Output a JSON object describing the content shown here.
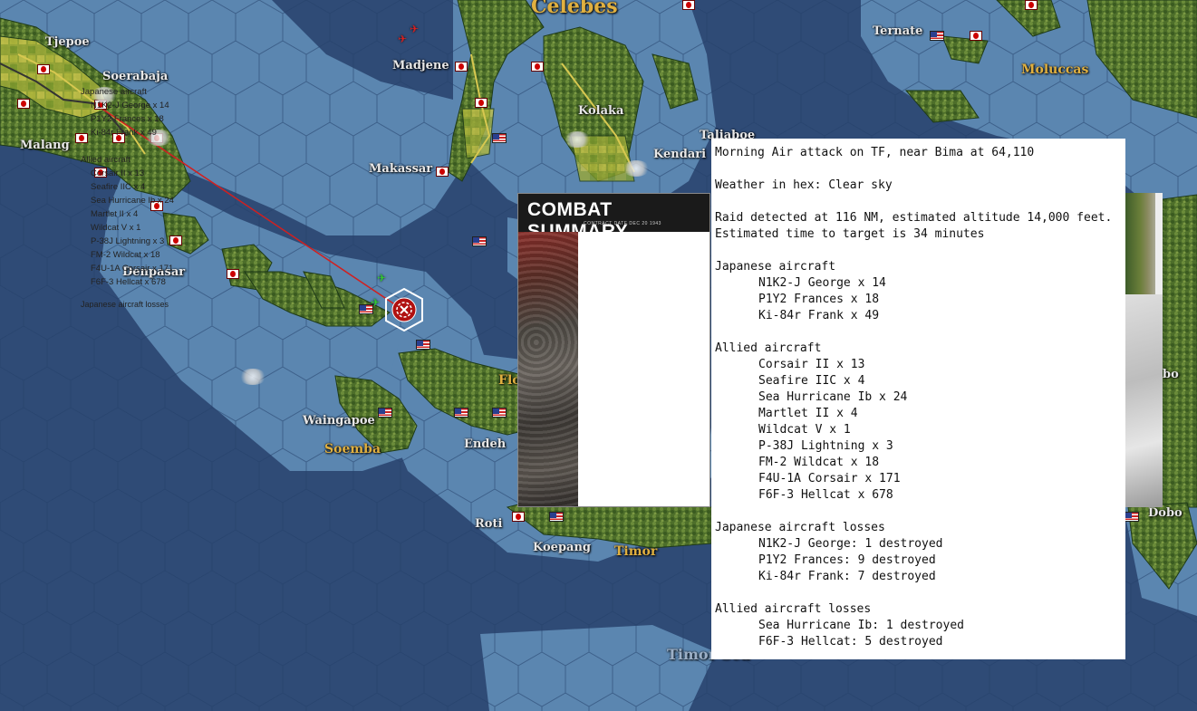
{
  "map": {
    "places": {
      "tjepoe": "Tjepoe",
      "soerabaja": "Soerabaja",
      "madjene": "Madjene",
      "ternate": "Ternate",
      "malang": "Malang",
      "kolaka": "Kolaka",
      "taliaboe": "Taliaboe",
      "makassar": "Makassar",
      "kendari": "Kendari",
      "denpasar": "Denpasar",
      "waingapoe": "Waingapoe",
      "endeh": "Endeh",
      "roti": "Roti",
      "koepang": "Koepang",
      "dobo": "Dobo",
      "flores_partial": "Flo",
      "right_edge_partial": "bo"
    },
    "regions": {
      "celebes": "Celebes",
      "moluccas": "Moluccas",
      "soemba": "Soemba",
      "timor": "Timor",
      "timor_sea": "Timor Sea"
    },
    "colors": {
      "sea_deep": "#2f4b76",
      "sea_shallow": "#5f89b2",
      "land": "#55752e",
      "attack_line": "#d02020"
    }
  },
  "combat_summary_card": {
    "title": "COMBAT SUMMARY",
    "subtitle": "CONTRACT DATE  DEC 20 1943",
    "japanese_header": "Japanese aircraft",
    "japanese": [
      "N1K2-J George x 14",
      "P1Y2 Frances x 18",
      "Ki-84r Frank x 49"
    ],
    "allied_header": "Allied aircraft",
    "allied": [
      "Corsair II x 13",
      "Seafire IIC x 4",
      "Sea Hurricane Ib x 24",
      "Martlet II x 4",
      "Wildcat V x 1",
      "P-38J Lightning x 3",
      "FM-2 Wildcat x 18",
      "F4U-1A Corsair x 171",
      "F6F-3 Hellcat x 678"
    ],
    "losses_header_partial": "Japanese aircraft losses"
  },
  "combat_report": {
    "headline": "Morning Air attack on TF, near Bima at 64,110",
    "weather": "Weather in hex: Clear sky",
    "raid_detected": "Raid detected at 116 NM, estimated altitude 14,000 feet.",
    "time_to_target": "Estimated time to target is 34 minutes",
    "japanese_header": "Japanese aircraft",
    "japanese": [
      "N1K2-J George x 14",
      "P1Y2 Frances x 18",
      "Ki-84r Frank x 49"
    ],
    "allied_header": "Allied aircraft",
    "allied": [
      "Corsair II x 13",
      "Seafire IIC x 4",
      "Sea Hurricane Ib x 24",
      "Martlet II x 4",
      "Wildcat V x 1",
      "P-38J Lightning x 3",
      "FM-2 Wildcat x 18",
      "F4U-1A Corsair x 171",
      "F6F-3 Hellcat x 678"
    ],
    "japanese_losses_header": "Japanese aircraft losses",
    "japanese_losses": [
      "N1K2-J George: 1 destroyed",
      "P1Y2 Frances: 9 destroyed",
      "Ki-84r Frank: 7 destroyed"
    ],
    "allied_losses_header": "Allied aircraft losses",
    "allied_losses": [
      "Sea Hurricane Ib: 1 destroyed",
      "F6F-3 Hellcat: 5 destroyed"
    ]
  }
}
